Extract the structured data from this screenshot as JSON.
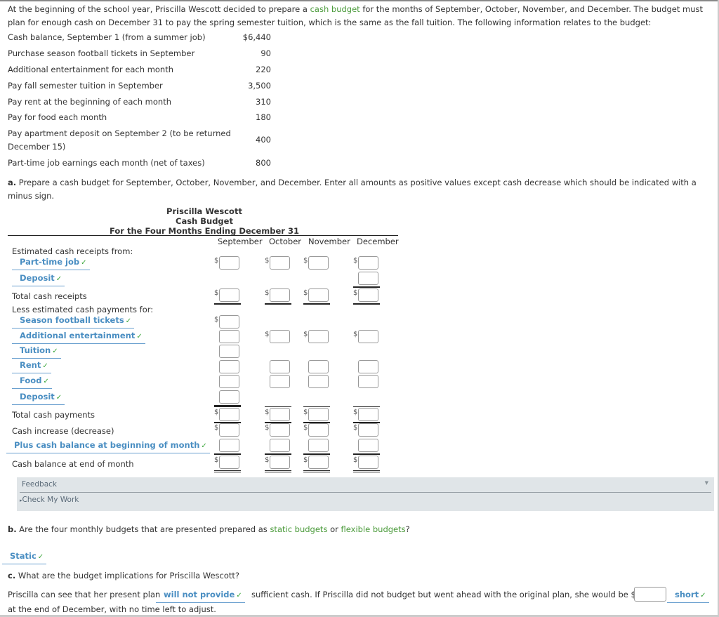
{
  "intro": {
    "part1": "At the beginning of the school year, Priscilla Wescott decided to prepare a ",
    "term": "cash budget",
    "part2": " for the months of September, October, November, and December. The budget must plan for enough cash on December 31 to pay the spring semester tuition, which is the same as the fall tuition. The following information relates to the budget:"
  },
  "given": [
    {
      "label": "Cash balance, September 1 (from a summer job)",
      "value": "$6,440"
    },
    {
      "label": "Purchase season football tickets in September",
      "value": "90"
    },
    {
      "label": "Additional entertainment for each month",
      "value": "220"
    },
    {
      "label": "Pay fall semester tuition in September",
      "value": "3,500"
    },
    {
      "label": "Pay rent at the beginning of each month",
      "value": "310"
    },
    {
      "label": "Pay for food each month",
      "value": "180"
    },
    {
      "label": "Pay apartment deposit on September 2 (to be returned December 15)",
      "value": "400"
    },
    {
      "label": "Part-time job earnings each month (net of taxes)",
      "value": "800"
    }
  ],
  "question_a": {
    "letter": "a.",
    "text": " Prepare a cash budget for September, October, November, and December. Enter all amounts as positive values except cash decrease which should be indicated with a minus sign."
  },
  "budget": {
    "company": "Priscilla Wescott",
    "title": "Cash Budget",
    "period": "For the Four Months Ending December 31",
    "columns": [
      "September",
      "October",
      "November",
      "December"
    ],
    "receipts_header": "Estimated cash receipts from:",
    "receipt_items": [
      {
        "label": "Part-time job",
        "check": "✓"
      },
      {
        "label": "Deposit",
        "check": "✓"
      }
    ],
    "total_receipts": "Total cash receipts",
    "payments_header": "Less estimated cash payments for:",
    "payment_items": [
      {
        "label": "Season football tickets",
        "check": "✓"
      },
      {
        "label": "Additional entertainment",
        "check": "✓"
      },
      {
        "label": "Tuition",
        "check": "✓"
      },
      {
        "label": "Rent",
        "check": "✓"
      },
      {
        "label": "Food",
        "check": "✓"
      },
      {
        "label": "Deposit",
        "check": "✓"
      }
    ],
    "total_payments": "Total cash payments",
    "increase": "Cash increase (decrease)",
    "beginning": {
      "label": "Plus cash balance at beginning of month",
      "check": "✓"
    },
    "ending": "Cash balance at end of month",
    "currency": "$"
  },
  "feedback": {
    "title": "Feedback",
    "check_my_work": "Check My Work",
    "toggle": "▼",
    "bullet": "▸"
  },
  "question_b": {
    "letter": "b.",
    "text1": " Are the four monthly budgets that are presented prepared as ",
    "term1": "static budgets",
    "text2": " or ",
    "term2": "flexible budgets",
    "text3": "?",
    "answer": "Static",
    "check": "✓"
  },
  "question_c": {
    "letter": "c.",
    "text": " What are the budget implications for Priscilla Wescott?",
    "line1_a": "Priscilla can see that her present plan",
    "dropdown": "will not provide",
    "check": "✓",
    "line1_b": "sufficient cash. If Priscilla did not budget but went ahead with the original plan, she would be $",
    "short": "short",
    "line2": "at the end of December, with no time left to adjust."
  }
}
